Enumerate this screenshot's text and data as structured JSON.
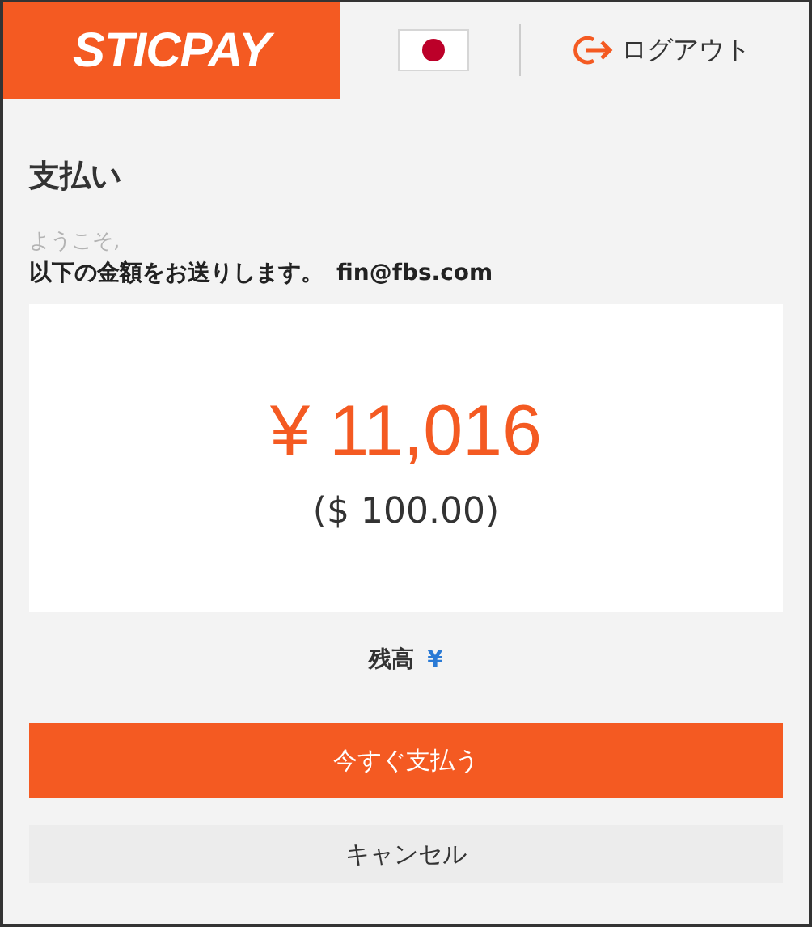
{
  "header": {
    "logo": "STICPAY",
    "logout": "ログアウト"
  },
  "title": "支払い",
  "welcome": "ようこそ,",
  "message": "以下の金額をお送りします。",
  "email": "fin@fbs.com",
  "amount": {
    "value": "¥ 11,016",
    "converted": "($ 100.00)"
  },
  "balance": {
    "label": "残高",
    "value": "¥"
  },
  "buttons": [
    {
      "kind": "primary",
      "label": "今すぐ支払う"
    },
    {
      "kind": "secondary",
      "label": "キャンセル"
    }
  ]
}
